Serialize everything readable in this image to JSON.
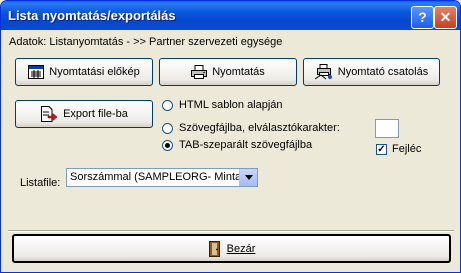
{
  "window": {
    "title": "Lista nyomtatás/exportálás",
    "help_label": "?",
    "close_label": "✕"
  },
  "info_text": "Adatok: Listanyomtatás - >> Partner szervezeti egysége",
  "buttons": {
    "preview": "Nyomtatási előkép",
    "print": "Nyomtatás",
    "printer_connect": "Nyomtató csatolás",
    "export": "Export file-ba",
    "close": "Bezár"
  },
  "export_options": {
    "html_template": "HTML sablon alapján",
    "text_separator": "Szövegfájlba, elválasztókarakter:",
    "tab_separated": "TAB-szeparált szövegfájlba",
    "selected": "tab_separated"
  },
  "header_checkbox": {
    "label": "Fejléc",
    "checked": true
  },
  "listfile": {
    "label": "Listafile:",
    "value": "Sorszámmal    (SAMPLEORG- Minta"
  },
  "icons": {
    "preview": "preview-icon",
    "print": "printer-icon",
    "printer_connect": "printer-connect-icon",
    "export": "export-icon",
    "close": "exit-door-icon"
  }
}
